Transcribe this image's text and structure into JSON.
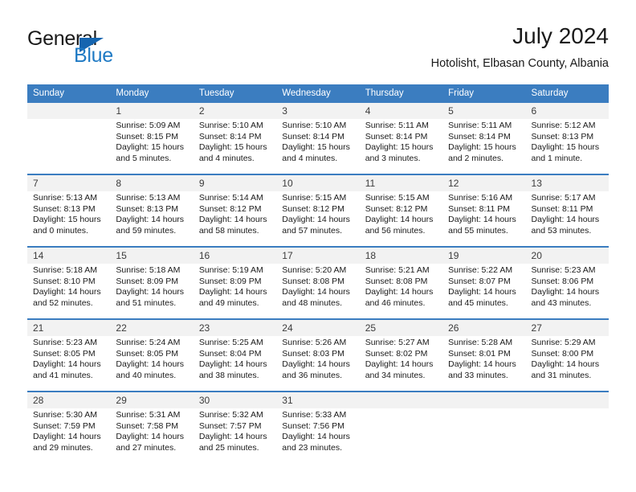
{
  "brand": {
    "name_part1": "General",
    "name_part2": "Blue",
    "triangle_icon": "triangle-icon",
    "accent_color": "#1f7ac4"
  },
  "header": {
    "title": "July 2024",
    "subtitle": "Hotolisht, Elbasan County, Albania"
  },
  "calendar": {
    "header_color": "#3b7dc0",
    "weekday_headers": [
      "Sunday",
      "Monday",
      "Tuesday",
      "Wednesday",
      "Thursday",
      "Friday",
      "Saturday"
    ],
    "weeks": [
      [
        {
          "day": "",
          "sunrise": "",
          "sunset": "",
          "daylight1": "",
          "daylight2": ""
        },
        {
          "day": "1",
          "sunrise": "Sunrise: 5:09 AM",
          "sunset": "Sunset: 8:15 PM",
          "daylight1": "Daylight: 15 hours",
          "daylight2": "and 5 minutes."
        },
        {
          "day": "2",
          "sunrise": "Sunrise: 5:10 AM",
          "sunset": "Sunset: 8:14 PM",
          "daylight1": "Daylight: 15 hours",
          "daylight2": "and 4 minutes."
        },
        {
          "day": "3",
          "sunrise": "Sunrise: 5:10 AM",
          "sunset": "Sunset: 8:14 PM",
          "daylight1": "Daylight: 15 hours",
          "daylight2": "and 4 minutes."
        },
        {
          "day": "4",
          "sunrise": "Sunrise: 5:11 AM",
          "sunset": "Sunset: 8:14 PM",
          "daylight1": "Daylight: 15 hours",
          "daylight2": "and 3 minutes."
        },
        {
          "day": "5",
          "sunrise": "Sunrise: 5:11 AM",
          "sunset": "Sunset: 8:14 PM",
          "daylight1": "Daylight: 15 hours",
          "daylight2": "and 2 minutes."
        },
        {
          "day": "6",
          "sunrise": "Sunrise: 5:12 AM",
          "sunset": "Sunset: 8:13 PM",
          "daylight1": "Daylight: 15 hours",
          "daylight2": "and 1 minute."
        }
      ],
      [
        {
          "day": "7",
          "sunrise": "Sunrise: 5:13 AM",
          "sunset": "Sunset: 8:13 PM",
          "daylight1": "Daylight: 15 hours",
          "daylight2": "and 0 minutes."
        },
        {
          "day": "8",
          "sunrise": "Sunrise: 5:13 AM",
          "sunset": "Sunset: 8:13 PM",
          "daylight1": "Daylight: 14 hours",
          "daylight2": "and 59 minutes."
        },
        {
          "day": "9",
          "sunrise": "Sunrise: 5:14 AM",
          "sunset": "Sunset: 8:12 PM",
          "daylight1": "Daylight: 14 hours",
          "daylight2": "and 58 minutes."
        },
        {
          "day": "10",
          "sunrise": "Sunrise: 5:15 AM",
          "sunset": "Sunset: 8:12 PM",
          "daylight1": "Daylight: 14 hours",
          "daylight2": "and 57 minutes."
        },
        {
          "day": "11",
          "sunrise": "Sunrise: 5:15 AM",
          "sunset": "Sunset: 8:12 PM",
          "daylight1": "Daylight: 14 hours",
          "daylight2": "and 56 minutes."
        },
        {
          "day": "12",
          "sunrise": "Sunrise: 5:16 AM",
          "sunset": "Sunset: 8:11 PM",
          "daylight1": "Daylight: 14 hours",
          "daylight2": "and 55 minutes."
        },
        {
          "day": "13",
          "sunrise": "Sunrise: 5:17 AM",
          "sunset": "Sunset: 8:11 PM",
          "daylight1": "Daylight: 14 hours",
          "daylight2": "and 53 minutes."
        }
      ],
      [
        {
          "day": "14",
          "sunrise": "Sunrise: 5:18 AM",
          "sunset": "Sunset: 8:10 PM",
          "daylight1": "Daylight: 14 hours",
          "daylight2": "and 52 minutes."
        },
        {
          "day": "15",
          "sunrise": "Sunrise: 5:18 AM",
          "sunset": "Sunset: 8:09 PM",
          "daylight1": "Daylight: 14 hours",
          "daylight2": "and 51 minutes."
        },
        {
          "day": "16",
          "sunrise": "Sunrise: 5:19 AM",
          "sunset": "Sunset: 8:09 PM",
          "daylight1": "Daylight: 14 hours",
          "daylight2": "and 49 minutes."
        },
        {
          "day": "17",
          "sunrise": "Sunrise: 5:20 AM",
          "sunset": "Sunset: 8:08 PM",
          "daylight1": "Daylight: 14 hours",
          "daylight2": "and 48 minutes."
        },
        {
          "day": "18",
          "sunrise": "Sunrise: 5:21 AM",
          "sunset": "Sunset: 8:08 PM",
          "daylight1": "Daylight: 14 hours",
          "daylight2": "and 46 minutes."
        },
        {
          "day": "19",
          "sunrise": "Sunrise: 5:22 AM",
          "sunset": "Sunset: 8:07 PM",
          "daylight1": "Daylight: 14 hours",
          "daylight2": "and 45 minutes."
        },
        {
          "day": "20",
          "sunrise": "Sunrise: 5:23 AM",
          "sunset": "Sunset: 8:06 PM",
          "daylight1": "Daylight: 14 hours",
          "daylight2": "and 43 minutes."
        }
      ],
      [
        {
          "day": "21",
          "sunrise": "Sunrise: 5:23 AM",
          "sunset": "Sunset: 8:05 PM",
          "daylight1": "Daylight: 14 hours",
          "daylight2": "and 41 minutes."
        },
        {
          "day": "22",
          "sunrise": "Sunrise: 5:24 AM",
          "sunset": "Sunset: 8:05 PM",
          "daylight1": "Daylight: 14 hours",
          "daylight2": "and 40 minutes."
        },
        {
          "day": "23",
          "sunrise": "Sunrise: 5:25 AM",
          "sunset": "Sunset: 8:04 PM",
          "daylight1": "Daylight: 14 hours",
          "daylight2": "and 38 minutes."
        },
        {
          "day": "24",
          "sunrise": "Sunrise: 5:26 AM",
          "sunset": "Sunset: 8:03 PM",
          "daylight1": "Daylight: 14 hours",
          "daylight2": "and 36 minutes."
        },
        {
          "day": "25",
          "sunrise": "Sunrise: 5:27 AM",
          "sunset": "Sunset: 8:02 PM",
          "daylight1": "Daylight: 14 hours",
          "daylight2": "and 34 minutes."
        },
        {
          "day": "26",
          "sunrise": "Sunrise: 5:28 AM",
          "sunset": "Sunset: 8:01 PM",
          "daylight1": "Daylight: 14 hours",
          "daylight2": "and 33 minutes."
        },
        {
          "day": "27",
          "sunrise": "Sunrise: 5:29 AM",
          "sunset": "Sunset: 8:00 PM",
          "daylight1": "Daylight: 14 hours",
          "daylight2": "and 31 minutes."
        }
      ],
      [
        {
          "day": "28",
          "sunrise": "Sunrise: 5:30 AM",
          "sunset": "Sunset: 7:59 PM",
          "daylight1": "Daylight: 14 hours",
          "daylight2": "and 29 minutes."
        },
        {
          "day": "29",
          "sunrise": "Sunrise: 5:31 AM",
          "sunset": "Sunset: 7:58 PM",
          "daylight1": "Daylight: 14 hours",
          "daylight2": "and 27 minutes."
        },
        {
          "day": "30",
          "sunrise": "Sunrise: 5:32 AM",
          "sunset": "Sunset: 7:57 PM",
          "daylight1": "Daylight: 14 hours",
          "daylight2": "and 25 minutes."
        },
        {
          "day": "31",
          "sunrise": "Sunrise: 5:33 AM",
          "sunset": "Sunset: 7:56 PM",
          "daylight1": "Daylight: 14 hours",
          "daylight2": "and 23 minutes."
        },
        {
          "day": "",
          "sunrise": "",
          "sunset": "",
          "daylight1": "",
          "daylight2": ""
        },
        {
          "day": "",
          "sunrise": "",
          "sunset": "",
          "daylight1": "",
          "daylight2": ""
        },
        {
          "day": "",
          "sunrise": "",
          "sunset": "",
          "daylight1": "",
          "daylight2": ""
        }
      ]
    ]
  }
}
